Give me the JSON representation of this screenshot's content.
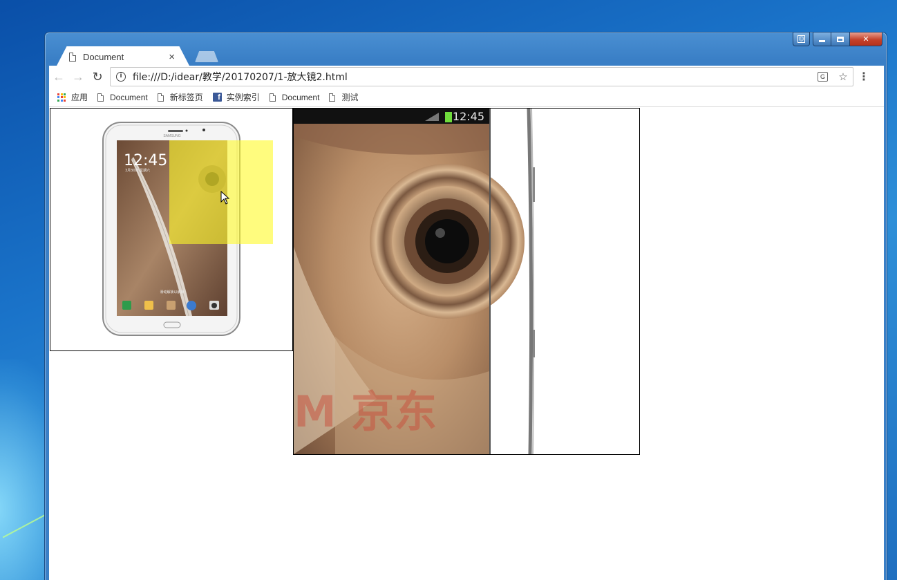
{
  "window": {
    "controls": {
      "user": "☺",
      "minimize": "",
      "maximize": "",
      "close": "✕"
    }
  },
  "tab": {
    "title": "Document",
    "close": "×"
  },
  "toolbar": {
    "back": "←",
    "forward": "→",
    "reload": "↻",
    "info": "i",
    "url": "file:///D:/idear/教学/20170207/1-放大镜2.html",
    "translate": "G",
    "star": "☆",
    "menu": "⋮"
  },
  "bookmarks": [
    {
      "label": "应用",
      "icon": "apps-icon"
    },
    {
      "label": "Document",
      "icon": "page-icon"
    },
    {
      "label": "新标签页",
      "icon": "page-icon"
    },
    {
      "label": "实例索引",
      "icon": "facebook-icon"
    },
    {
      "label": "Document",
      "icon": "page-icon"
    },
    {
      "label": "测试",
      "icon": "page-icon"
    }
  ],
  "product": {
    "brand": "SAMSUNG",
    "clock": "12:45",
    "date": "3月30日 星期六",
    "unlock_hint": "滑动解锁以解锁",
    "status_time": "12:45",
    "watermark": "M 京东"
  },
  "colors": {
    "lens": "#fffa28",
    "chrome_accent": "#3a7fc6",
    "close_button": "#c4412a"
  }
}
